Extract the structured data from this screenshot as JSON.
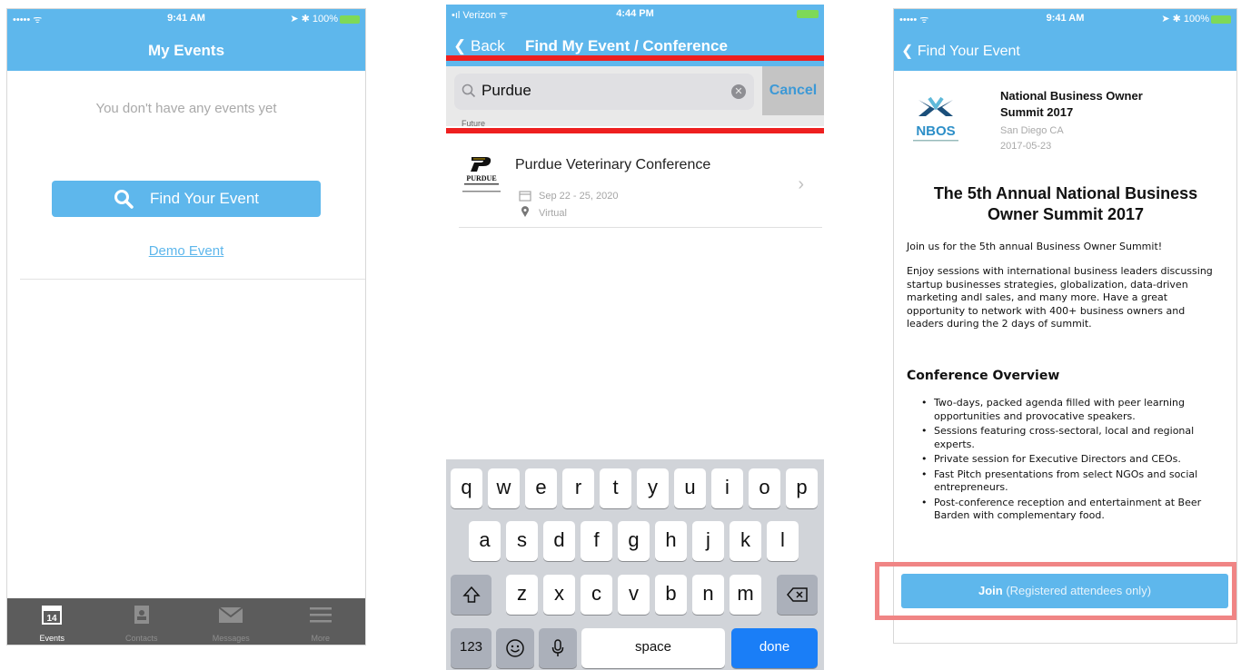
{
  "colors": {
    "accent": "#5eb7ec",
    "highlight_red": "#ee1f1f",
    "highlight_pink": "#f08585",
    "keyboard_done": "#1a7ef7"
  },
  "screen1": {
    "status": {
      "left": "••••• ᯤ",
      "time": "9:41 AM",
      "right": "➤ ✱ 100%"
    },
    "title": "My Events",
    "empty_message": "You don't have any events yet",
    "find_button": {
      "label": "Find Your Event",
      "icon": "search-icon"
    },
    "demo_link": "Demo Event",
    "tabs": [
      {
        "label": "Events",
        "icon": "calendar-icon",
        "badge": "14"
      },
      {
        "label": "Contacts",
        "icon": "contacts-icon"
      },
      {
        "label": "Messages",
        "icon": "envelope-icon"
      },
      {
        "label": "More",
        "icon": "menu-icon"
      }
    ]
  },
  "screen2": {
    "status": {
      "left": "•ıl Verizon ᯤ",
      "time": "4:44 PM",
      "right": "⚡"
    },
    "back": "Back",
    "title": "Find My Event / Conference",
    "search": {
      "value": "Purdue",
      "cancel": "Cancel"
    },
    "section": "Future",
    "result": {
      "title": "Purdue Veterinary Conference",
      "date": "Sep 22 - 25, 2020",
      "location": "Virtual",
      "logo_text": "PURDUE"
    },
    "keyboard": {
      "row1": [
        "q",
        "w",
        "e",
        "r",
        "t",
        "y",
        "u",
        "i",
        "o",
        "p"
      ],
      "row2": [
        "a",
        "s",
        "d",
        "f",
        "g",
        "h",
        "j",
        "k",
        "l"
      ],
      "row3": [
        "z",
        "x",
        "c",
        "v",
        "b",
        "n",
        "m"
      ],
      "numbers": "123",
      "space": "space",
      "done": "done"
    }
  },
  "screen3": {
    "status": {
      "left": "••••• ᯤ",
      "time": "9:41 AM",
      "right": "➤ ✱ 100%"
    },
    "back": "Find Your Event",
    "event_name": "National Business Owner Summit 2017",
    "event_location": "San Diego CA",
    "event_date": "2017-05-23",
    "logo_text": "NBOS",
    "heading": "The 5th Annual National Business Owner Summit 2017",
    "intro": "Join us for the 5th annual Business Owner Summit!",
    "description": "Enjoy sessions with international business leaders discussing startup businesses strategies, globalization, data-driven marketing andl sales, and many more. Have a great opportunity to network with 400+ business owners and leaders during the 2 days of summit.",
    "overview_title": "Conference Overview",
    "bullets": [
      "Two-days, packed agenda filled with peer learning opportunities and provocative speakers.",
      "Sessions featuring cross-sectoral, local and regional experts.",
      "Private session for Executive Directors and CEOs.",
      "Fast Pitch presentations from select NGOs and social entrepreneurs.",
      "Post-conference reception and entertainment at Beer Barden with complementary food."
    ],
    "join_label": "Join",
    "join_sub": "(Registered attendees only)"
  }
}
